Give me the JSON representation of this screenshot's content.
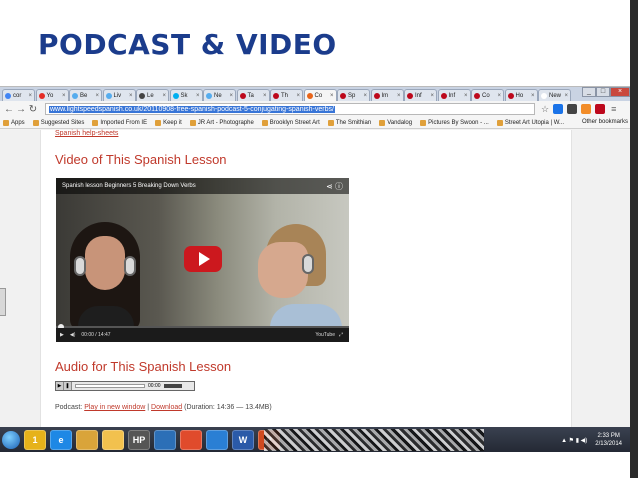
{
  "slide": {
    "title": "PODCAST & VIDEO"
  },
  "browser": {
    "tabs": [
      {
        "label": "cor",
        "color": "#4285f4"
      },
      {
        "label": "Yo",
        "color": "#e52d27"
      },
      {
        "label": "Be",
        "color": "#55acee"
      },
      {
        "label": "Liv",
        "color": "#55acee"
      },
      {
        "label": "Le",
        "color": "#444444"
      },
      {
        "label": "Sk",
        "color": "#00aff0"
      },
      {
        "label": "Ne",
        "color": "#55acee"
      },
      {
        "label": "Ta",
        "color": "#bd081c"
      },
      {
        "label": "Th",
        "color": "#bd081c"
      },
      {
        "label": "Co",
        "color": "#e8651a"
      },
      {
        "label": "Sp",
        "color": "#bd081c"
      },
      {
        "label": "Im",
        "color": "#bd081c"
      },
      {
        "label": "Inf",
        "color": "#bd081c"
      },
      {
        "label": "Inf",
        "color": "#bd081c"
      },
      {
        "label": "Co",
        "color": "#bd081c"
      },
      {
        "label": "Ho",
        "color": "#bd081c"
      },
      {
        "label": "New",
        "color": "#ffffff"
      }
    ],
    "url": "www.lightspeedspanish.co.uk/20110908-free-spanish-podcast-5-conjugating-spanish-verbs/",
    "bookmarks": [
      "Apps",
      "Suggested Sites",
      "Imported From IE",
      "Keep it",
      "JR Art - Photographe",
      "Brooklyn Street Art",
      "The Smithian",
      "Vandalog",
      "Pictures By Swoon - ...",
      "Street Art Utopia | W..."
    ],
    "other_bookmarks": "Other bookmarks"
  },
  "page": {
    "help_link": "Spanish help-sheets",
    "video_heading": "Video of This Spanish Lesson",
    "video": {
      "title": "Spanish lesson Beginners 5 Breaking Down Verbs",
      "time": "00:00 / 14:47",
      "brand": "YouTube"
    },
    "audio_heading": "Audio for This Spanish Lesson",
    "audio": {
      "time": "00:00"
    },
    "podcast": {
      "prefix": "Podcast:",
      "play_link": "Play in new window",
      "sep": "|",
      "download_link": "Download",
      "duration": "(Duration: 14:36 — 13.4MB)"
    }
  },
  "taskbar": {
    "apps": [
      "1",
      "e",
      "",
      "",
      "HP",
      "",
      "",
      "",
      "W",
      "P"
    ],
    "time": "2:33 PM",
    "date": "2/13/2014"
  }
}
